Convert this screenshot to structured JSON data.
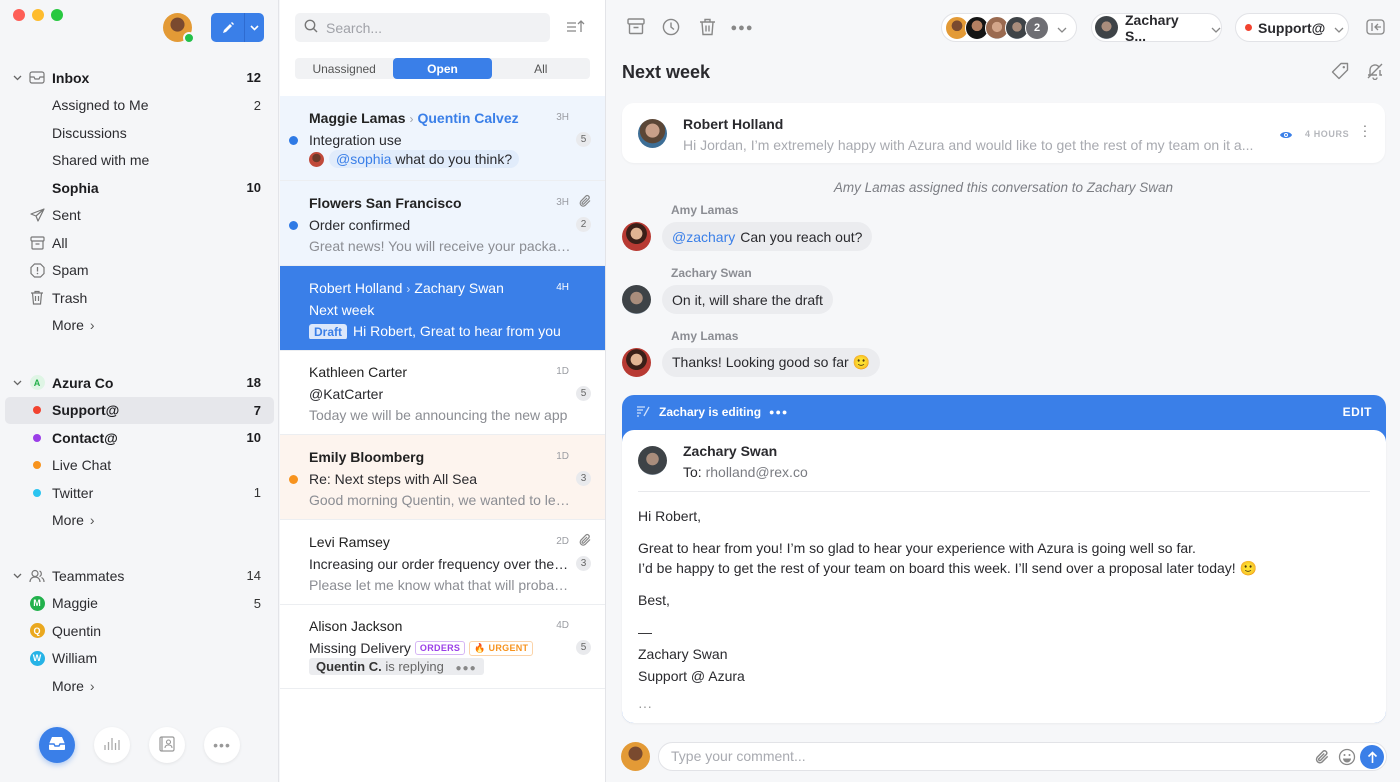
{
  "app": {
    "accent": "#3a7fe8",
    "traffic_lights": [
      "#fe5f57",
      "#febc2e",
      "#28c840"
    ]
  },
  "sidebar": {
    "user_avatar": "sophia-avatar",
    "compose_label": "compose",
    "inbox": {
      "label": "Inbox",
      "count": "12",
      "items": [
        {
          "label": "Assigned to Me",
          "count": "2",
          "bold": false
        },
        {
          "label": "Discussions",
          "count": "",
          "bold": false
        },
        {
          "label": "Shared with me",
          "count": "",
          "bold": false
        },
        {
          "label": "Sophia",
          "count": "10",
          "bold": true
        }
      ]
    },
    "folders": [
      {
        "label": "Sent",
        "icon": "send-icon"
      },
      {
        "label": "All",
        "icon": "archive-icon"
      },
      {
        "label": "Spam",
        "icon": "spam-icon"
      },
      {
        "label": "Trash",
        "icon": "trash-icon"
      }
    ],
    "more_label": "More",
    "team": {
      "label": "Azura Co",
      "count": "18",
      "letter": "A",
      "color": "#23b04a",
      "items": [
        {
          "label": "Support@",
          "count": "7",
          "color": "#f2432f",
          "bold": true,
          "active": true
        },
        {
          "label": "Contact@",
          "count": "10",
          "color": "#9b3ee8",
          "bold": true
        },
        {
          "label": "Live Chat",
          "count": "",
          "color": "#f7931e",
          "bold": false
        },
        {
          "label": "Twitter",
          "count": "1",
          "color": "#2bc4f0",
          "bold": false
        }
      ]
    },
    "teammates": {
      "label": "Teammates",
      "count": "14",
      "items": [
        {
          "label": "Maggie",
          "letter": "M",
          "count": "5",
          "color": "#22b14c"
        },
        {
          "label": "Quentin",
          "letter": "Q",
          "count": "",
          "color": "#eaa81f"
        },
        {
          "label": "William",
          "letter": "W",
          "count": "",
          "color": "#26b3e6"
        }
      ]
    },
    "bottom_nav": [
      "inbox-icon",
      "analytics-icon",
      "contacts-icon",
      "more-icon"
    ]
  },
  "list": {
    "search_placeholder": "Search...",
    "filters": [
      "Unassigned",
      "Open",
      "All"
    ],
    "active_filter": "Open",
    "conversations": [
      {
        "from": "Maggie Lamas",
        "to": "Quentin Calvez",
        "subject": "Integration use",
        "mention": "@sophia",
        "preview": "what do you think?",
        "time": "3H",
        "count": "5",
        "unread": true,
        "dot": "#2f7ae5"
      },
      {
        "from": "Flowers San Francisco",
        "subject": "Order confirmed",
        "preview": "Great news! You will receive your package",
        "time": "3H",
        "count": "2",
        "unread": true,
        "dot": "#2f7ae5",
        "attachment": true
      },
      {
        "from": "Robert Holland",
        "to": "Zachary Swan",
        "subject": "Next week",
        "draft_label": "Draft",
        "preview": "Hi Robert, Great to hear from you",
        "time": "4H",
        "selected": true
      },
      {
        "from": "Kathleen Carter",
        "subject": "@KatCarter",
        "preview": "Today we will be announcing the new app",
        "time": "1D",
        "count": "5"
      },
      {
        "from": "Emily Bloomberg",
        "subject": "Re: Next steps with All Sea",
        "preview": "Good morning Quentin, we wanted to let you know",
        "time": "1D",
        "count": "3",
        "unread": true,
        "dot": "#f7931e"
      },
      {
        "from": "Levi Ramsey",
        "subject": "Increasing our order frequency over the next quarter",
        "preview": "Please let me know what that will probably be",
        "time": "2D",
        "count": "3",
        "attachment": true
      },
      {
        "from": "Alison Jackson",
        "subject": "Missing Delivery",
        "tags": [
          {
            "label": "ORDERS",
            "color": "#9b3ee8"
          },
          {
            "label": "🔥 URGENT",
            "color": "#f7931e"
          }
        ],
        "replier": "Quentin C.",
        "replying_text": "is replying",
        "time": "4D",
        "count": "5"
      }
    ]
  },
  "main": {
    "toolbar": [
      "archive-icon",
      "snooze-icon",
      "trash-icon",
      "more-icon"
    ],
    "participants_extra": "2",
    "assignee": "Zachary S...",
    "inbox_label": "Support@",
    "inbox_color": "#f2432f",
    "title": "Next week",
    "email_card": {
      "from": "Robert Holland",
      "preview": "Hi Jordan, I’m extremely happy with Azura and would like to get the rest of my team on it a...",
      "time": "4 HOURS"
    },
    "system_message": "Amy Lamas assigned this conversation to Zachary Swan",
    "comments": [
      {
        "author": "Amy Lamas",
        "mention": "@zachary",
        "text": "Can you reach out?"
      },
      {
        "author": "Zachary Swan",
        "text": "On it, will share the draft"
      },
      {
        "author": "Amy Lamas",
        "text": "Thanks! Looking good so far 🙂"
      }
    ],
    "draft": {
      "editing_label": "Zachary is editing",
      "edit_label": "EDIT",
      "from": "Zachary Swan",
      "to_label": "To:",
      "to": "rholland@rex.co",
      "body": [
        "Hi Robert,",
        "Great to hear from you! I’m so glad to hear your experience with Azura is going well so far.",
        "I’d be happy to get the rest of your team on board this week. I’ll send over a proposal later today! 🙂",
        "Best,",
        "—",
        "Zachary Swan",
        "Support @ Azura",
        "···"
      ]
    },
    "comment_placeholder": "Type your comment..."
  }
}
